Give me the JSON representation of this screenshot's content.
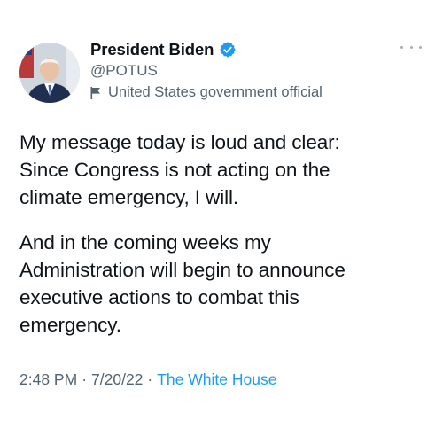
{
  "author": {
    "display_name": "President Biden",
    "handle": "@POTUS",
    "label": "United States government official",
    "verified": true
  },
  "icons": {
    "verified": "verified-badge-icon",
    "label": "flag-icon",
    "more": "more-options-icon"
  },
  "tweet": {
    "paragraphs": [
      {
        "lines": [
          "My message today is loud and clear:",
          "Since Congress is not acting on the",
          "climate emergency, I will."
        ]
      },
      {
        "lines": [
          "And in the coming weeks my",
          "Administration will begin to announce",
          "executive actions to combat this",
          "emergency."
        ]
      }
    ],
    "time": "2:48 PM",
    "date": "7/20/22",
    "separator": "·",
    "source": "The White House"
  },
  "colors": {
    "text": "#0f1419",
    "secondary": "#536471",
    "link": "#1d9bf0",
    "verified": "#1d9bf0"
  }
}
